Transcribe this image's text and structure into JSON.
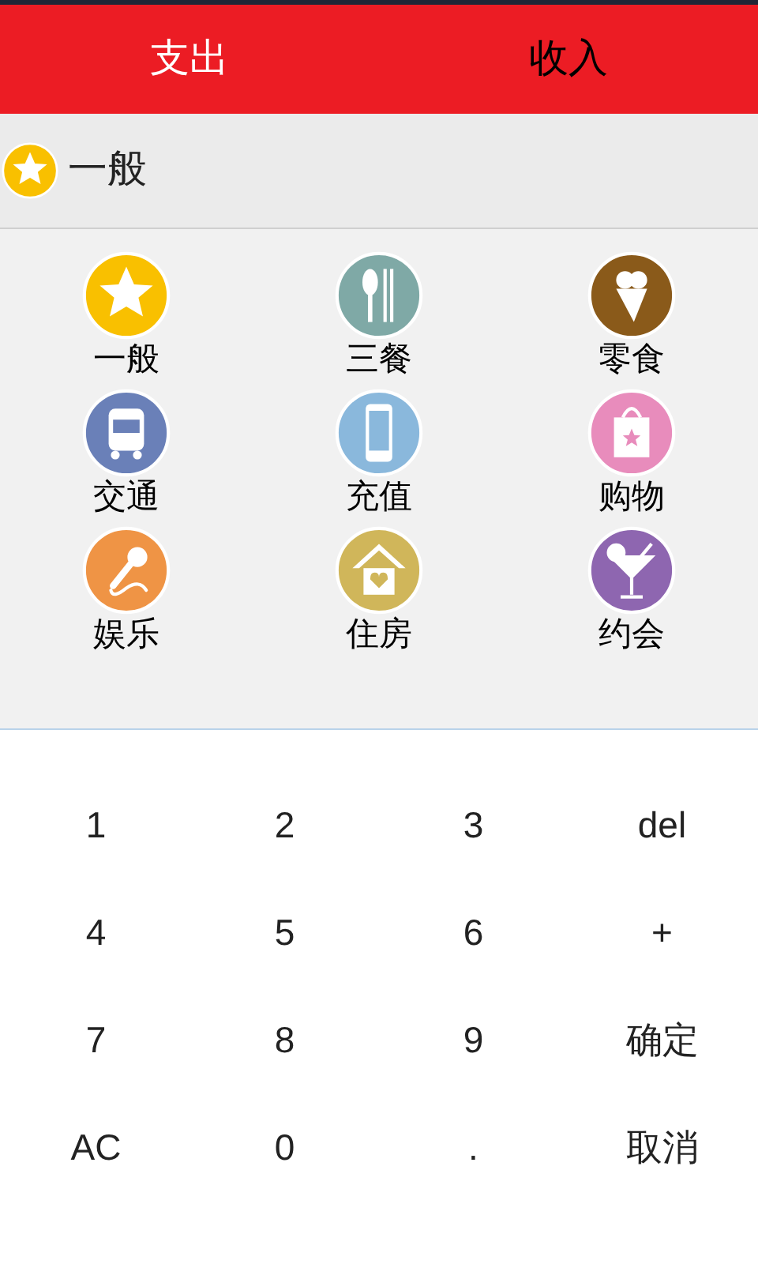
{
  "tabs": [
    {
      "label": "支出",
      "selected": true
    },
    {
      "label": "收入",
      "selected": false
    }
  ],
  "current_category": {
    "label": "一般",
    "kind": "star",
    "color": "#f9c000"
  },
  "categories": [
    {
      "label": "一般",
      "kind": "star",
      "color": "#f9c000"
    },
    {
      "label": "三餐",
      "kind": "cutlery",
      "color": "#7fa9a6"
    },
    {
      "label": "零食",
      "kind": "icecream",
      "color": "#8a5a1a"
    },
    {
      "label": "交通",
      "kind": "bus",
      "color": "#6a80b8"
    },
    {
      "label": "充值",
      "kind": "phone",
      "color": "#8ab8dc"
    },
    {
      "label": "购物",
      "kind": "bag",
      "color": "#e88cbc"
    },
    {
      "label": "娱乐",
      "kind": "mic",
      "color": "#ef9445"
    },
    {
      "label": "住房",
      "kind": "house",
      "color": "#d0b65a"
    },
    {
      "label": "约会",
      "kind": "cocktail",
      "color": "#8e66b0"
    }
  ],
  "keypad": [
    "1",
    "2",
    "3",
    "del",
    "4",
    "5",
    "6",
    "+",
    "7",
    "8",
    "9",
    "确定",
    "AC",
    "0",
    ".",
    "取消"
  ]
}
